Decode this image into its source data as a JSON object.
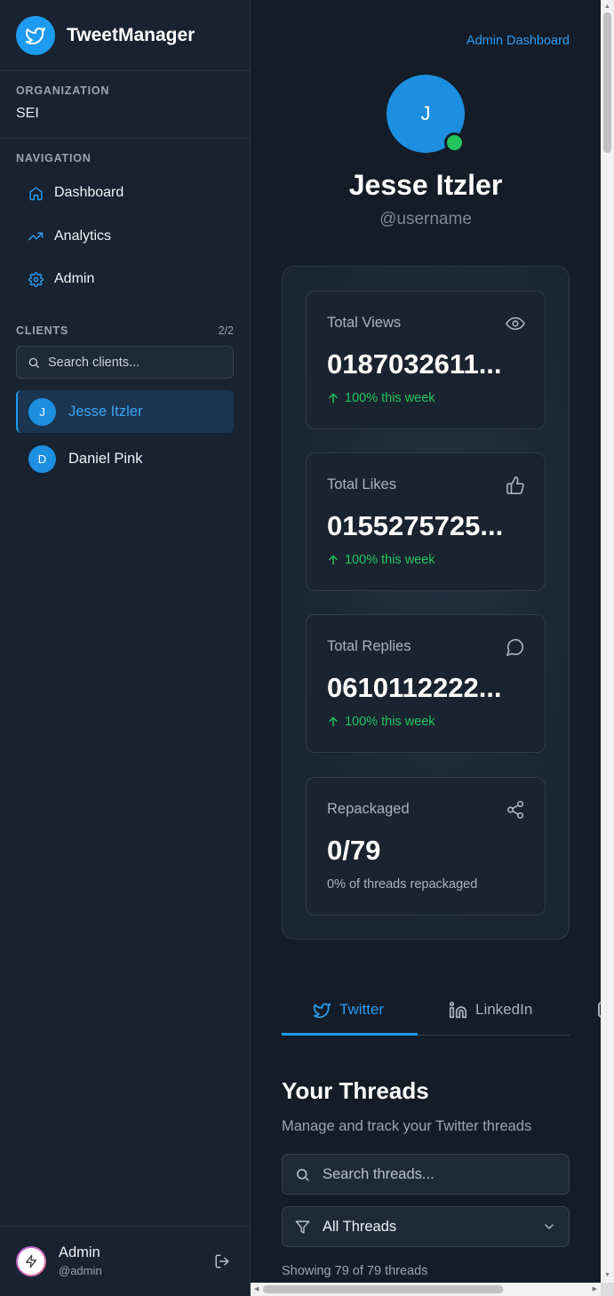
{
  "app": {
    "name": "TweetManager"
  },
  "sidebar": {
    "organization_label": "ORGANIZATION",
    "organization_name": "SEI",
    "navigation_label": "NAVIGATION",
    "nav_items": [
      {
        "label": "Dashboard",
        "icon": "home-icon"
      },
      {
        "label": "Analytics",
        "icon": "trending-icon"
      },
      {
        "label": "Admin",
        "icon": "gear-icon"
      }
    ],
    "clients_label": "CLIENTS",
    "clients_count": "2/2",
    "client_search_placeholder": "Search clients...",
    "clients": [
      {
        "initial": "J",
        "name": "Jesse Itzler",
        "active": true
      },
      {
        "initial": "D",
        "name": "Daniel Pink",
        "active": false
      }
    ],
    "admin": {
      "name": "Admin",
      "handle": "@admin"
    }
  },
  "main": {
    "admin_link": "Admin Dashboard",
    "profile": {
      "initial": "J",
      "name": "Jesse Itzler",
      "handle": "@username"
    },
    "stats": [
      {
        "title": "Total Views",
        "value": "0187032611...",
        "sub": "100% this week",
        "icon": "eye-icon"
      },
      {
        "title": "Total Likes",
        "value": "0155275725...",
        "sub": "100% this week",
        "icon": "thumbs-up-icon"
      },
      {
        "title": "Total Replies",
        "value": "0610112222...",
        "sub": "100% this week",
        "icon": "message-circle-icon"
      },
      {
        "title": "Repackaged",
        "value": "0/79",
        "sub": "0% of threads repackaged",
        "icon": "share-icon"
      }
    ],
    "tabs": [
      {
        "label": "Twitter",
        "active": true
      },
      {
        "label": "LinkedIn",
        "active": false
      }
    ],
    "threads": {
      "title": "Your Threads",
      "subtitle": "Manage and track your Twitter threads",
      "search_placeholder": "Search threads...",
      "filter_value": "All Threads",
      "showing": "Showing 79 of 79 threads"
    }
  },
  "colors": {
    "accent": "#1d9bf0",
    "success": "#22c55e",
    "sidebar_bg": "#182230",
    "main_bg": "#131c27"
  }
}
